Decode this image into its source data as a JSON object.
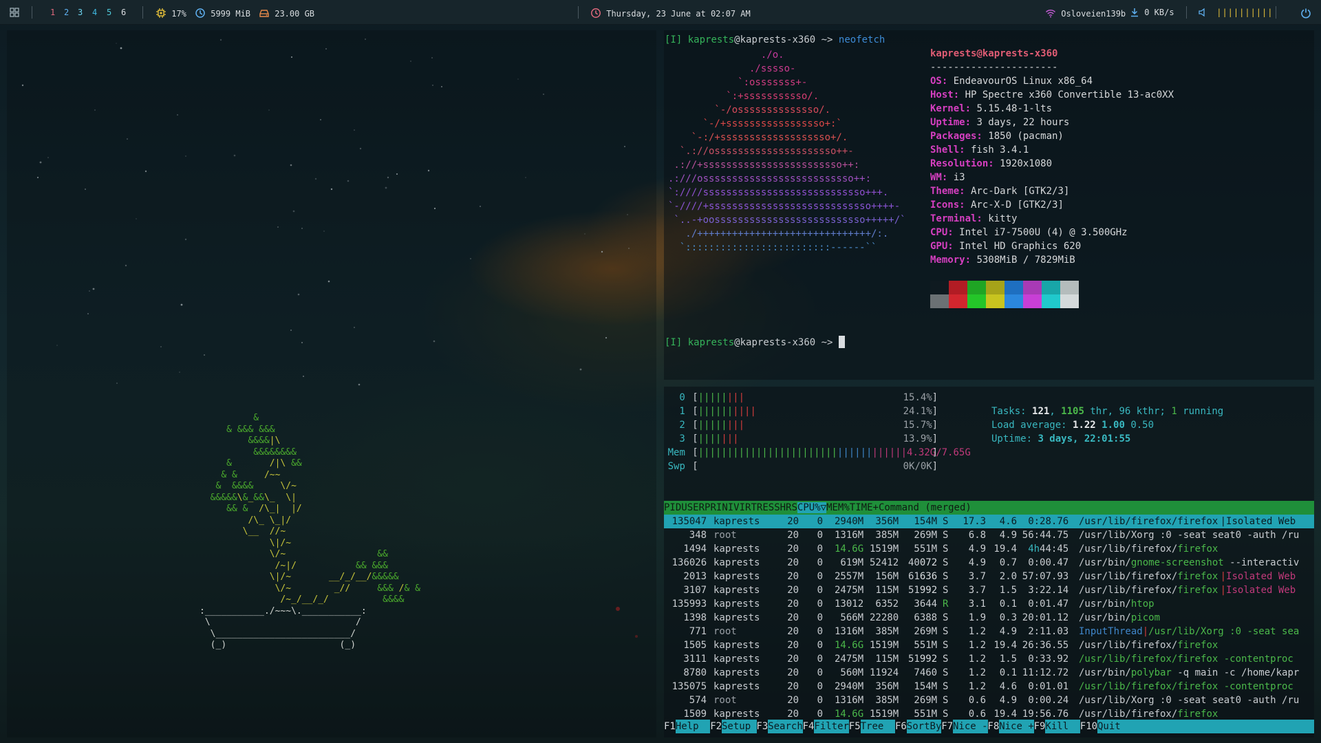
{
  "bar": {
    "workspaces": [
      "1",
      "2",
      "3",
      "4",
      "5",
      "6"
    ],
    "cpu": "17%",
    "ram": "5999 MiB",
    "disk": "23.00 GB",
    "datetime": "Thursday, 23 June at 02:07 AM",
    "wifi": "Osloveien139b",
    "net": "0 KB/s",
    "volume_bars": "||||||||||"
  },
  "neofetch": {
    "prompt1": {
      "tag": "[I]",
      "user": "kaprests",
      "host": "@kaprests-x360",
      "arrow": " ~> ",
      "cmd": "neofetch"
    },
    "logo": [
      "                ./o.",
      "              ./sssso-",
      "            `:osssssss+-",
      "          `:+sssssssssso/.",
      "        `-/ossssssssssssso/.",
      "      `-/+sssssssssssssssso+:`",
      "    `-:/+sssssssssssssssssso+/.",
      "  `.://osssssssssssssssssssso++-",
      " .://+ssssssssssssssssssssssso++:",
      ".:///ossssssssssssssssssssssssso++:",
      "`:////ssssssssssssssssssssssssssso+++.",
      "`-////+ssssssssssssssssssssssssssso++++-",
      " `..-+oossssssssssssssssssssssssso+++++/`",
      "   ./++++++++++++++++++++++++++++++/:.",
      "  `:::::::::::::::::::::::::------``"
    ],
    "title_user": "kaprests",
    "title_host": "@kaprests-x360",
    "divider": "----------------------",
    "info": [
      {
        "k": "OS",
        "v": " EndeavourOS Linux x86_64"
      },
      {
        "k": "Host",
        "v": " HP Spectre x360 Convertible 13-ac0XX"
      },
      {
        "k": "Kernel",
        "v": " 5.15.48-1-lts"
      },
      {
        "k": "Uptime",
        "v": " 3 days, 22 hours"
      },
      {
        "k": "Packages",
        "v": " 1850 (pacman)"
      },
      {
        "k": "Shell",
        "v": " fish 3.4.1"
      },
      {
        "k": "Resolution",
        "v": " 1920x1080"
      },
      {
        "k": "WM",
        "v": " i3"
      },
      {
        "k": "Theme",
        "v": " Arc-Dark [GTK2/3]"
      },
      {
        "k": "Icons",
        "v": " Arc-X-D [GTK2/3]"
      },
      {
        "k": "Terminal",
        "v": " kitty"
      },
      {
        "k": "CPU",
        "v": " Intel i7-7500U (4) @ 3.500GHz"
      },
      {
        "k": "GPU",
        "v": " Intel HD Graphics 620"
      },
      {
        "k": "Memory",
        "v": " 5308MiB / 7829MiB"
      }
    ],
    "palette_top": [
      "#0f1a20",
      "#b21c24",
      "#1fa524",
      "#a6a319",
      "#1e6fc0",
      "#a83ab5",
      "#18a6a8",
      "#b4bcbc"
    ],
    "palette_bottom": [
      "#6b7174",
      "#d2262e",
      "#24c529",
      "#c8c41f",
      "#2b87dd",
      "#c83fd6",
      "#20c9cc",
      "#d4dadb"
    ],
    "prompt2": {
      "tag": "[I]",
      "user": "kaprests",
      "host": "@kaprests-x360",
      "arrow": " ~> "
    }
  },
  "htop": {
    "cpus": [
      {
        "id": "0",
        "bars": "||||||||",
        "pct": "15.4%"
      },
      {
        "id": "1",
        "bars": "||||||||||",
        "pct": "24.1%"
      },
      {
        "id": "2",
        "bars": "||||||||",
        "pct": "15.7%"
      },
      {
        "id": "3",
        "bars": "|||||||",
        "pct": "13.9%"
      }
    ],
    "mem": {
      "label": "Mem",
      "bars": "||||||||||||||||||||||||||||||||||||",
      "val": "4.32G/7.65G"
    },
    "swp": {
      "label": "Swp",
      "val": "0K/0K"
    },
    "tasks": {
      "label": "Tasks: ",
      "a": "121",
      "b": "1105",
      "c": " thr, 96 kthr; ",
      "d": "1",
      "e": " running"
    },
    "load": {
      "label": "Load average: ",
      "a": "1.22",
      "b": "1.00",
      "c": "0.50"
    },
    "uptime": {
      "label": "Uptime: ",
      "v": "3 days, 22:01:55"
    },
    "columns": [
      "PID",
      "USER",
      "PRI",
      "NI",
      "VIRT",
      "RES",
      "SHR",
      "S",
      "CPU%▽",
      "MEM%",
      "TIME+",
      "Command (merged)"
    ],
    "rows": [
      [
        "135047",
        "kaprests",
        "20",
        "0",
        "2940M",
        "356M",
        "154M",
        "S",
        "17.3",
        "4.6",
        "0:28.76",
        "/usr/lib/firefox/firefox",
        "Isolated Web"
      ],
      [
        "348",
        "root",
        "20",
        "0",
        "1316M",
        "385M",
        "269M",
        "S",
        "6.8",
        "4.9",
        "56:44.75",
        "/usr/lib/Xorg :0 -seat seat0 -auth /ru",
        ""
      ],
      [
        "1494",
        "kaprests",
        "20",
        "0",
        "14.6G",
        "1519M",
        "551M",
        "S",
        "4.9",
        "19.4",
        "4h44:45",
        "/usr/lib/firefox/firefox",
        ""
      ],
      [
        "136026",
        "kaprests",
        "20",
        "0",
        "619M",
        "52412",
        "40072",
        "S",
        "4.9",
        "0.7",
        "0:00.47",
        "/usr/bin/gnome-screenshot --interactiv",
        ""
      ],
      [
        "2013",
        "kaprests",
        "20",
        "0",
        "2557M",
        "156M",
        "61636",
        "S",
        "3.7",
        "2.0",
        "57:07.93",
        "/usr/lib/firefox/firefox",
        "Isolated Web"
      ],
      [
        "3107",
        "kaprests",
        "20",
        "0",
        "2475M",
        "115M",
        "51992",
        "S",
        "3.7",
        "1.5",
        "3:22.14",
        "/usr/lib/firefox/firefox",
        "Isolated Web"
      ],
      [
        "135993",
        "kaprests",
        "20",
        "0",
        "13012",
        "6352",
        "3644",
        "R",
        "3.1",
        "0.1",
        "0:01.47",
        "/usr/bin/htop",
        ""
      ],
      [
        "1398",
        "kaprests",
        "20",
        "0",
        "566M",
        "22280",
        "6388",
        "S",
        "1.9",
        "0.3",
        "20:01.12",
        "/usr/bin/picom",
        ""
      ],
      [
        "771",
        "root",
        "20",
        "0",
        "1316M",
        "385M",
        "269M",
        "S",
        "1.2",
        "4.9",
        "2:11.03",
        "InputThread",
        "/usr/lib/Xorg :0 -seat sea"
      ],
      [
        "1505",
        "kaprests",
        "20",
        "0",
        "14.6G",
        "1519M",
        "551M",
        "S",
        "1.2",
        "19.4",
        "26:36.55",
        "/usr/lib/firefox/firefox",
        ""
      ],
      [
        "3111",
        "kaprests",
        "20",
        "0",
        "2475M",
        "115M",
        "51992",
        "S",
        "1.2",
        "1.5",
        "0:33.92",
        "/usr/lib/firefox/firefox -contentproc",
        ""
      ],
      [
        "8780",
        "kaprests",
        "20",
        "0",
        "560M",
        "11924",
        "7460",
        "S",
        "1.2",
        "0.1",
        "11:12.72",
        "/usr/bin/polybar -q main -c /home/kapr",
        ""
      ],
      [
        "135075",
        "kaprests",
        "20",
        "0",
        "2940M",
        "356M",
        "154M",
        "S",
        "1.2",
        "4.6",
        "0:01.01",
        "/usr/lib/firefox/firefox -contentproc",
        ""
      ],
      [
        "574",
        "root",
        "20",
        "0",
        "1316M",
        "385M",
        "269M",
        "S",
        "0.6",
        "4.9",
        "0:00.24",
        "/usr/lib/Xorg :0 -seat seat0 -auth /ru",
        ""
      ],
      [
        "1509",
        "kaprests",
        "20",
        "0",
        "14.6G",
        "1519M",
        "551M",
        "S",
        "0.6",
        "19.4",
        "19:56.76",
        "/usr/lib/firefox/firefox",
        ""
      ]
    ],
    "fkeys": [
      {
        "k": "F1",
        "l": "Help  "
      },
      {
        "k": "F2",
        "l": "Setup "
      },
      {
        "k": "F3",
        "l": "Search"
      },
      {
        "k": "F4",
        "l": "Filter"
      },
      {
        "k": "F5",
        "l": "Tree  "
      },
      {
        "k": "F6",
        "l": "SortBy"
      },
      {
        "k": "F7",
        "l": "Nice -"
      },
      {
        "k": "F8",
        "l": "Nice +"
      },
      {
        "k": "F9",
        "l": "Kill  "
      },
      {
        "k": "F10",
        "l": "Quit  "
      }
    ]
  },
  "plant": [
    "          &",
    "     & &&& &&&",
    "         &&&&|\\",
    "          &&&&&&&&",
    "     &       /|\\ &&",
    "    & &     /~~",
    "   &  &&&&     \\/~",
    "  &&&&&\\&_&&\\_  \\|",
    "     && &  /\\_|  |/",
    "         /\\_ \\_|/",
    "        \\__  //~",
    "             \\|/~",
    "             \\/~                 &&",
    "              /~|/           && &&&",
    "             \\|/~       __/_/__/&&&&&",
    "              \\/~        _//     &&& /& &",
    "               /~_/__/_/          &&&&",
    ":___________./~~~\\.___________:",
    " \\                           /",
    "  \\_________________________/",
    "  (_)                     (_)"
  ]
}
